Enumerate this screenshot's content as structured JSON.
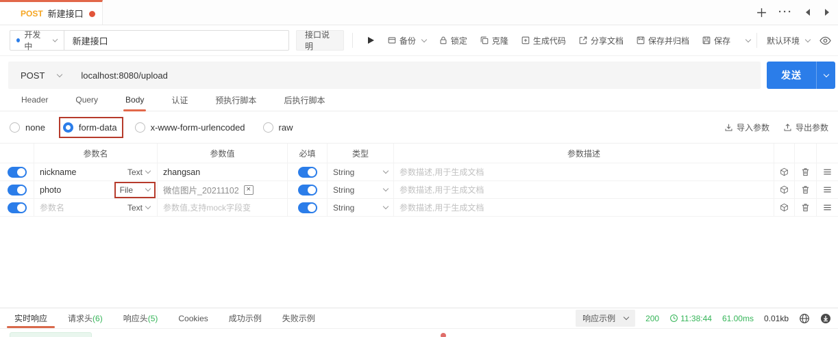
{
  "colors": {
    "accent_orange": "#e2684a",
    "method_orange": "#f5a623",
    "primary_blue": "#2b7de9",
    "success_green": "#35b558",
    "annotation_red": "#b63a2b"
  },
  "tab_bar": {
    "method": "POST",
    "title": "新建接口"
  },
  "toolbar": {
    "status_label": "开发中",
    "api_name": "新建接口",
    "doc_button": "接口说明",
    "actions": [
      {
        "label": "备份"
      },
      {
        "label": "锁定"
      },
      {
        "label": "克隆"
      },
      {
        "label": "生成代码"
      },
      {
        "label": "分享文档"
      },
      {
        "label": "保存并归档"
      },
      {
        "label": "保存"
      }
    ],
    "env_label": "默认环境"
  },
  "request_bar": {
    "method": "POST",
    "url": "localhost:8080/upload",
    "send_label": "发送"
  },
  "request_tabs": {
    "items": [
      "Header",
      "Query",
      "Body",
      "认证",
      "预执行脚本",
      "后执行脚本"
    ],
    "active": "Body"
  },
  "body_section": {
    "modes": [
      "none",
      "form-data",
      "x-www-form-urlencoded",
      "raw"
    ],
    "selected": "form-data",
    "import_label": "导入参数",
    "export_label": "导出参数"
  },
  "params_table": {
    "headers": {
      "name": "参数名",
      "value": "参数值",
      "required": "必填",
      "type": "类型",
      "desc": "参数描述"
    },
    "rows": [
      {
        "name": "nickname",
        "field_type": "Text",
        "value": "zhangsan",
        "data_type": "String",
        "desc_placeholder": "参数描述,用于生成文档"
      },
      {
        "name": "photo",
        "field_type": "File",
        "file_name": "微信图片_20211102",
        "data_type": "String",
        "desc_placeholder": "参数描述,用于生成文档"
      },
      {
        "name_placeholder": "参数名",
        "field_type": "Text",
        "value_placeholder": "参数值,支持mock字段变",
        "data_type": "String",
        "desc_placeholder": "参数描述,用于生成文档"
      }
    ]
  },
  "response_bar": {
    "tabs": [
      {
        "label": "实时响应",
        "count": ""
      },
      {
        "label": "请求头",
        "count": "(6)"
      },
      {
        "label": "响应头",
        "count": "(5)"
      },
      {
        "label": "Cookies",
        "count": ""
      },
      {
        "label": "成功示例",
        "count": ""
      },
      {
        "label": "失败示例",
        "count": ""
      }
    ],
    "active_tab": "实时响应",
    "example_dropdown": "响应示例",
    "status_code": "200",
    "time": "11:38:44",
    "duration": "61.00ms",
    "size": "0.01kb"
  }
}
